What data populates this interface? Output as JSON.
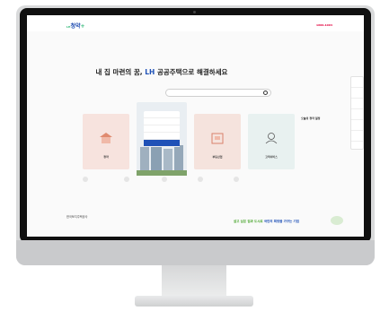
{
  "header": {
    "logo_prefix": "LH",
    "logo_main": "청약",
    "logo_plus": "+",
    "hotline_label": "1600-1004"
  },
  "hero": {
    "text_before": "내 집 마련의 꿈,",
    "brand": "LH",
    "text_after": "공공주택으로 해결하세요"
  },
  "search": {
    "placeholder": ""
  },
  "cards": [
    {
      "label": "청약"
    },
    {
      "label": ""
    },
    {
      "label": "부동산업"
    },
    {
      "label": "고객서비스"
    }
  ],
  "notice": {
    "title": "오늘의 청약 일정"
  },
  "footer": {
    "org": "한국토지주택공사",
    "slogan_pre": "살고 싶은 집과 도시로",
    "slogan_main": "국민의 희망을 가꾸는 기업"
  },
  "colors": {
    "brand_blue": "#1f51b7",
    "brand_green": "#2bb673",
    "hotline_red": "#e2003d"
  }
}
